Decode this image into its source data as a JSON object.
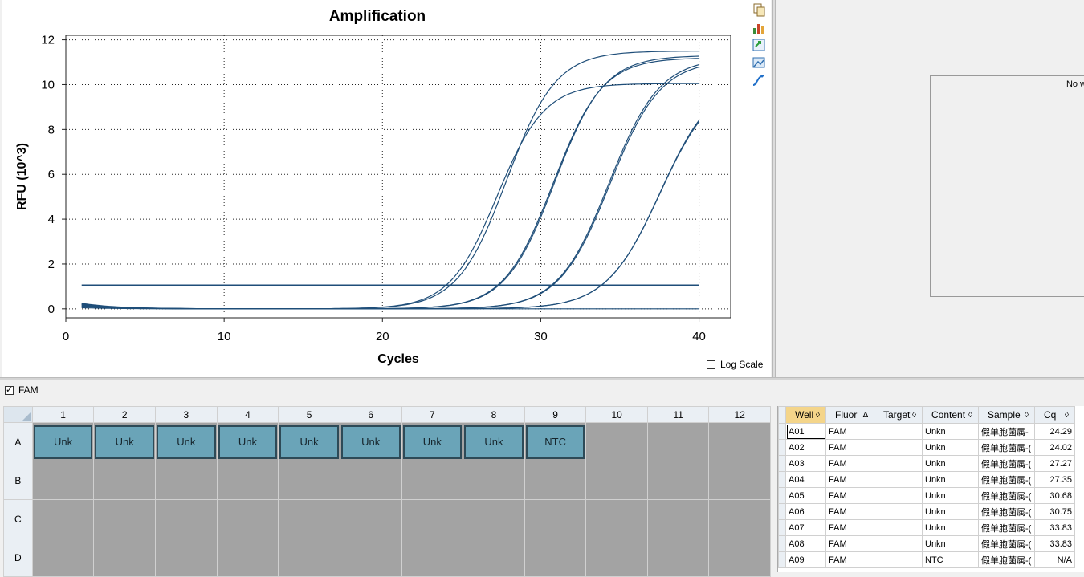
{
  "chart_data": {
    "type": "line",
    "title": "Amplification",
    "xlabel": "Cycles",
    "ylabel": "RFU (10^3)",
    "xlim": [
      0,
      42
    ],
    "ylim": [
      -0.4,
      12.2
    ],
    "xticks": [
      0,
      10,
      20,
      30,
      40
    ],
    "yticks": [
      0,
      2,
      4,
      6,
      8,
      10,
      12
    ],
    "grid": true,
    "threshold": 1.05,
    "curve_color": "#1f4e79",
    "x": [
      1,
      40
    ],
    "series": [
      {
        "well": "A01",
        "cq": 24.29,
        "plateau": 11.5,
        "slope": 1.55,
        "start": 0.22
      },
      {
        "well": "A02",
        "cq": 24.02,
        "plateau": 10.05,
        "slope": 1.5,
        "start": 0.18
      },
      {
        "well": "A03",
        "cq": 27.27,
        "plateau": 11.2,
        "slope": 1.55,
        "start": 0.25
      },
      {
        "well": "A04",
        "cq": 27.35,
        "plateau": 11.3,
        "slope": 1.55,
        "start": 0.15
      },
      {
        "well": "A05",
        "cq": 30.68,
        "plateau": 11.2,
        "slope": 1.6,
        "start": 0.2
      },
      {
        "well": "A06",
        "cq": 30.75,
        "plateau": 11.1,
        "slope": 1.6,
        "start": 0.12
      },
      {
        "well": "A07",
        "cq": 33.83,
        "plateau": 10.4,
        "slope": 1.7,
        "start": 0.18
      },
      {
        "well": "A08",
        "cq": 33.83,
        "plateau": 10.3,
        "slope": 1.7,
        "start": 0.1
      },
      {
        "well": "A09",
        "cq": null,
        "plateau": 0,
        "slope": 1,
        "start": 0.05
      }
    ]
  },
  "log_scale_label": "Log Scale",
  "no_well_text": "No w",
  "fluor_label": "FAM",
  "plate": {
    "columns": [
      "1",
      "2",
      "3",
      "4",
      "5",
      "6",
      "7",
      "8",
      "9",
      "10",
      "11",
      "12"
    ],
    "rows": [
      "A",
      "B",
      "C",
      "D"
    ],
    "row_a": [
      "Unk",
      "Unk",
      "Unk",
      "Unk",
      "Unk",
      "Unk",
      "Unk",
      "Unk",
      "NTC"
    ]
  },
  "table": {
    "headers": [
      "Well",
      "Fluor",
      "Target",
      "Content",
      "Sample",
      "Cq"
    ],
    "header_icons": [
      "◊",
      "∆",
      "◊",
      "◊",
      "◊",
      "◊"
    ],
    "rows": [
      [
        "A01",
        "FAM",
        "",
        "Unkn",
        "假单胞菌属-",
        "24.29"
      ],
      [
        "A02",
        "FAM",
        "",
        "Unkn",
        "假单胞菌属-(",
        "24.02"
      ],
      [
        "A03",
        "FAM",
        "",
        "Unkn",
        "假单胞菌属-(",
        "27.27"
      ],
      [
        "A04",
        "FAM",
        "",
        "Unkn",
        "假单胞菌属-(",
        "27.35"
      ],
      [
        "A05",
        "FAM",
        "",
        "Unkn",
        "假单胞菌属-(",
        "30.68"
      ],
      [
        "A06",
        "FAM",
        "",
        "Unkn",
        "假单胞菌属-(",
        "30.75"
      ],
      [
        "A07",
        "FAM",
        "",
        "Unkn",
        "假单胞菌属-(",
        "33.83"
      ],
      [
        "A08",
        "FAM",
        "",
        "Unkn",
        "假单胞菌属-(",
        "33.83"
      ],
      [
        "A09",
        "FAM",
        "",
        "NTC",
        "假单胞菌属-(",
        "N/A"
      ]
    ]
  },
  "toolbar_icons": [
    "copy-icon",
    "chart-settings-icon",
    "export-icon",
    "image-icon",
    "curve-icon"
  ]
}
